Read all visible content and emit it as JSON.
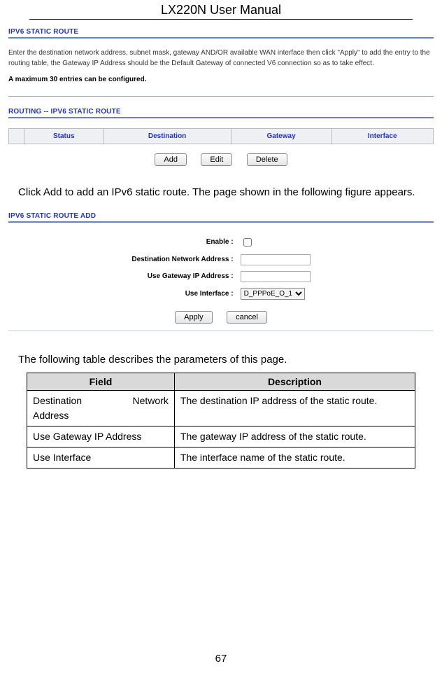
{
  "doc_title": "LX220N User Manual",
  "page_number": "67",
  "section1": {
    "title": "IPV6 STATIC ROUTE",
    "intro": "Enter the destination network address, subnet mask, gateway AND/OR available WAN interface then click \"Apply\" to add the entry to the routing table, the Gateway IP Address should be the Default Gateway of connected V6 connection so as to take effect.",
    "note": "A maximum 30 entries can be configured."
  },
  "section2": {
    "title": "ROUTING -- IPV6 STATIC ROUTE",
    "table_headers": {
      "status": "Status",
      "destination": "Destination",
      "gateway": "Gateway",
      "interface": "Interface"
    },
    "buttons": {
      "add": "Add",
      "edit": "Edit",
      "delete": "Delete"
    }
  },
  "para1": "Click Add to add an IPv6 static route. The page shown in the following figure appears.",
  "section3": {
    "title": "IPV6 STATIC ROUTE ADD",
    "labels": {
      "enable": "Enable :",
      "dest": "Destination Network Address :",
      "gw": "Use Gateway IP Address :",
      "iface": "Use Interface :"
    },
    "interface_value": "D_PPPoE_O_1",
    "buttons": {
      "apply": "Apply",
      "cancel": "cancel"
    }
  },
  "para2": "The following table describes the parameters of this page.",
  "param_table": {
    "headers": {
      "field": "Field",
      "desc": "Description"
    },
    "rows": [
      {
        "field_a": "Destination",
        "field_b": "Network",
        "field_line2": "Address",
        "desc": "The destination IP address of the static route."
      },
      {
        "field": "Use Gateway IP Address",
        "desc": "The gateway IP address of the static route."
      },
      {
        "field": "Use Interface",
        "desc": "The interface name of the static route."
      }
    ]
  }
}
